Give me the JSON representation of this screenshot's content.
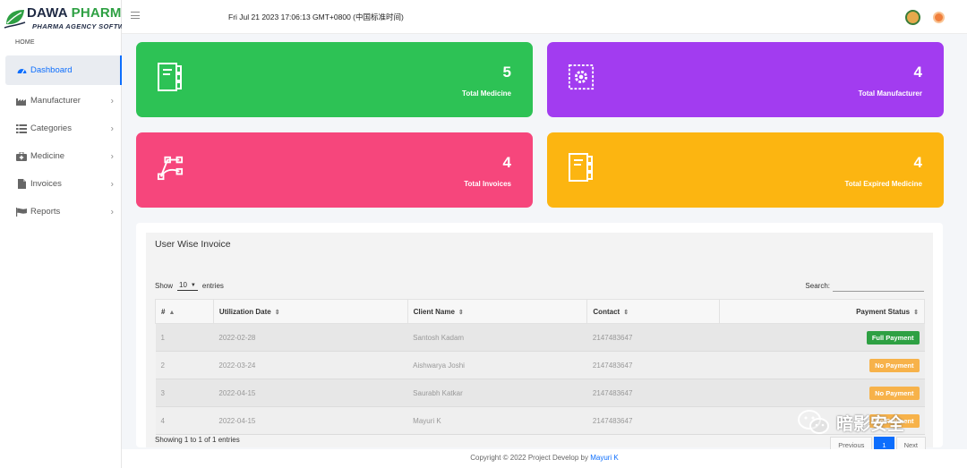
{
  "brand": {
    "title_dark": "DAWA",
    "title_green": "PHARMA",
    "subtitle": "PHARMA AGENCY SOFTWARE",
    "green": "#2ea043",
    "navy": "#1f2a44"
  },
  "header": {
    "datetime": "Fri Jul 21 2023 17:06:13 GMT+0800 (中国标准时间)",
    "menu_icon": "hamburger-icon"
  },
  "sidebar": {
    "section_label": "HOME",
    "items": [
      {
        "label": "Dashboard",
        "icon": "tachometer-icon"
      },
      {
        "label": "Manufacturer",
        "icon": "industry-icon"
      },
      {
        "label": "Categories",
        "icon": "list-icon"
      },
      {
        "label": "Medicine",
        "icon": "medkit-icon"
      },
      {
        "label": "Invoices",
        "icon": "file-icon"
      },
      {
        "label": "Reports",
        "icon": "flag-icon"
      }
    ]
  },
  "cards": [
    {
      "count": "5",
      "label": "Total Medicine",
      "color": "#2dc255",
      "icon": "notebook-icon"
    },
    {
      "count": "4",
      "label": "Total Manufacturer",
      "color": "#a23cf0",
      "icon": "gear-icon"
    },
    {
      "count": "4",
      "label": "Total Invoices",
      "color": "#f6467c",
      "icon": "vector-icon"
    },
    {
      "count": "4",
      "label": "Total Expired Medicine",
      "color": "#fcb511",
      "icon": "notebook-icon"
    }
  ],
  "table_panel": {
    "title": "User Wise Invoice",
    "show_label": "Show",
    "entries_value": "10",
    "entries_label": "entries",
    "search_label": "Search:",
    "search_value": "",
    "columns": [
      "#",
      "Utilization Date",
      "Client Name",
      "Contact",
      "Payment Status"
    ],
    "rows": [
      {
        "id": "1",
        "date": "2022-02-28",
        "client": "Santosh Kadam",
        "contact": "2147483647",
        "status": "Full Payment",
        "status_type": "full"
      },
      {
        "id": "2",
        "date": "2022-03-24",
        "client": "Aishwarya Joshi",
        "contact": "2147483647",
        "status": "No Payment",
        "status_type": "none"
      },
      {
        "id": "3",
        "date": "2022-04-15",
        "client": "Saurabh Katkar",
        "contact": "2147483647",
        "status": "No Payment",
        "status_type": "none"
      },
      {
        "id": "4",
        "date": "2022-04-15",
        "client": "Mayuri K",
        "contact": "2147483647",
        "status": "No Payment",
        "status_type": "none"
      }
    ],
    "info": "Showing 1 to 1 of 1 entries",
    "pagination": {
      "previous": "Previous",
      "current": "1",
      "next": "Next"
    }
  },
  "footer": {
    "text": "Copyright © 2022 Project Develop by",
    "author": "Mayuri K"
  },
  "watermark": {
    "text": "暗影安全",
    "icon": "wechat-icon"
  }
}
